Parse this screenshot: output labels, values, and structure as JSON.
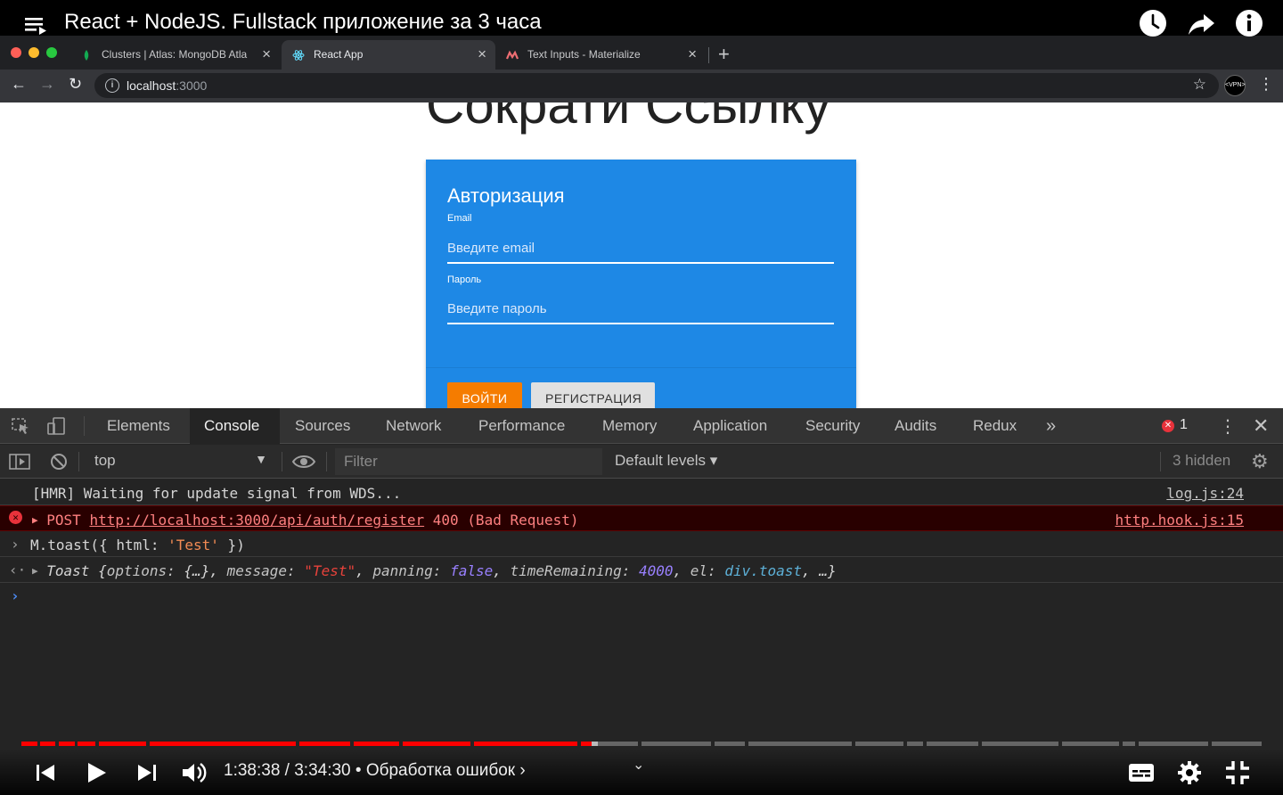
{
  "youtube": {
    "video_title": "React + NodeJS. Fullstack приложение за 3 часа",
    "time_current": "1:38:38",
    "time_total": "3:34:30",
    "time_display": "1:38:38 / 3:34:30 • Обработка ошибок ›",
    "chapter": "Обработка ошибок",
    "progress_fraction": 0.46,
    "buffered_fraction": 0.465,
    "progress_color": "#ff0000"
  },
  "browser": {
    "tabs": [
      {
        "title": "Clusters | Atlas: MongoDB Atla",
        "icon": "mongodb-leaf-icon",
        "active": false
      },
      {
        "title": "React App",
        "icon": "react-atom-icon",
        "active": true
      },
      {
        "title": "Text Inputs - Materialize",
        "icon": "materialize-icon",
        "active": false
      }
    ],
    "url_host": "localhost",
    "url_port": ":3000",
    "extension_label": "<VPN>"
  },
  "page": {
    "heading": "Сократи Ссылку",
    "card_title": "Авторизация",
    "email_label": "Email",
    "email_placeholder": "Введите email",
    "password_label": "Пароль",
    "password_placeholder": "Введите пароль",
    "login_button": "Войти",
    "register_button": "Регистрация",
    "card_color": "#1e88e5",
    "login_color": "#f57c00"
  },
  "devtools": {
    "tabs": [
      "Elements",
      "Console",
      "Sources",
      "Network",
      "Performance",
      "Memory",
      "Application",
      "Security",
      "Audits",
      "Redux"
    ],
    "active_tab": "Console",
    "more_tabs": "»",
    "error_count": "1",
    "context": "top",
    "filter_placeholder": "Filter",
    "levels": "Default levels ▾",
    "hidden": "3 hidden",
    "console": {
      "hmr_line": "[HMR] Waiting for update signal from WDS...",
      "hmr_source": "log.js:24",
      "error_method": "POST",
      "error_url": "http://localhost:3000/api/auth/register",
      "error_status": "400 (Bad Request)",
      "error_source": "http.hook.js:15",
      "input_code_pre": "M.toast({ html: ",
      "input_code_str": "'Test'",
      "input_code_post": " })",
      "result_class": "Toast",
      "result_brace_open": "{",
      "k_options": "options:",
      "v_options": "{…}",
      "k_message": "message:",
      "v_message": "\"Test\"",
      "k_panning": "panning:",
      "v_panning": "false",
      "k_time": "timeRemaining:",
      "v_time": "4000",
      "k_el": "el:",
      "v_el": "div.toast",
      "result_tail": ", …}"
    }
  }
}
